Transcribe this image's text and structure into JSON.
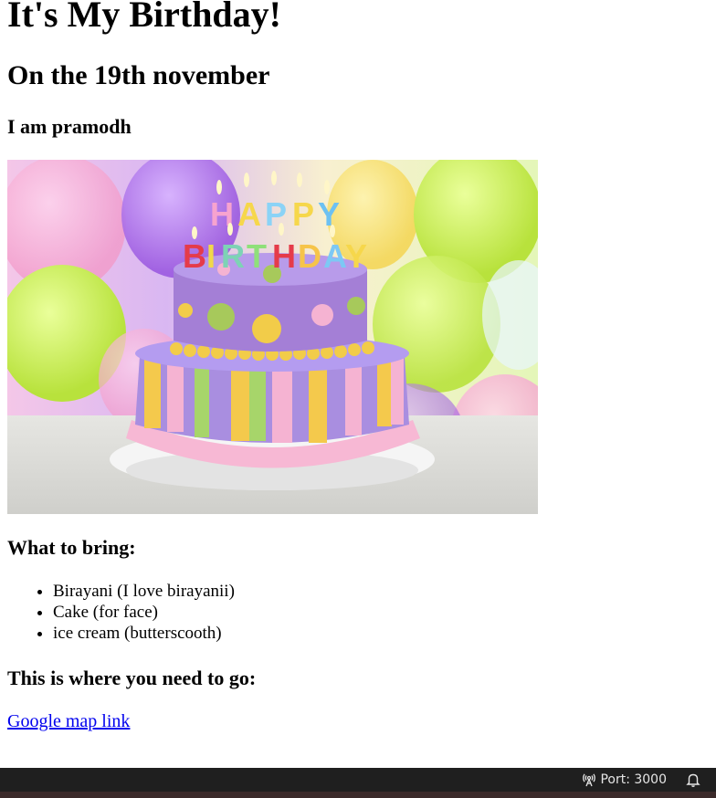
{
  "title": "It's My Birthday!",
  "subtitle": "On the 19th november",
  "intro": "I am pramodh",
  "bring_heading": "What to bring:",
  "bring_items": [
    "Birayani (I love birayanii)",
    "Cake (for face)",
    "ice cream (butterscooth)"
  ],
  "directions_heading": "This is where you need to go:",
  "map_link": "Google map link",
  "statusbar": {
    "port_label": "Port: 3000"
  },
  "cake_topper_text": "HAPPY BIRTHDAY"
}
